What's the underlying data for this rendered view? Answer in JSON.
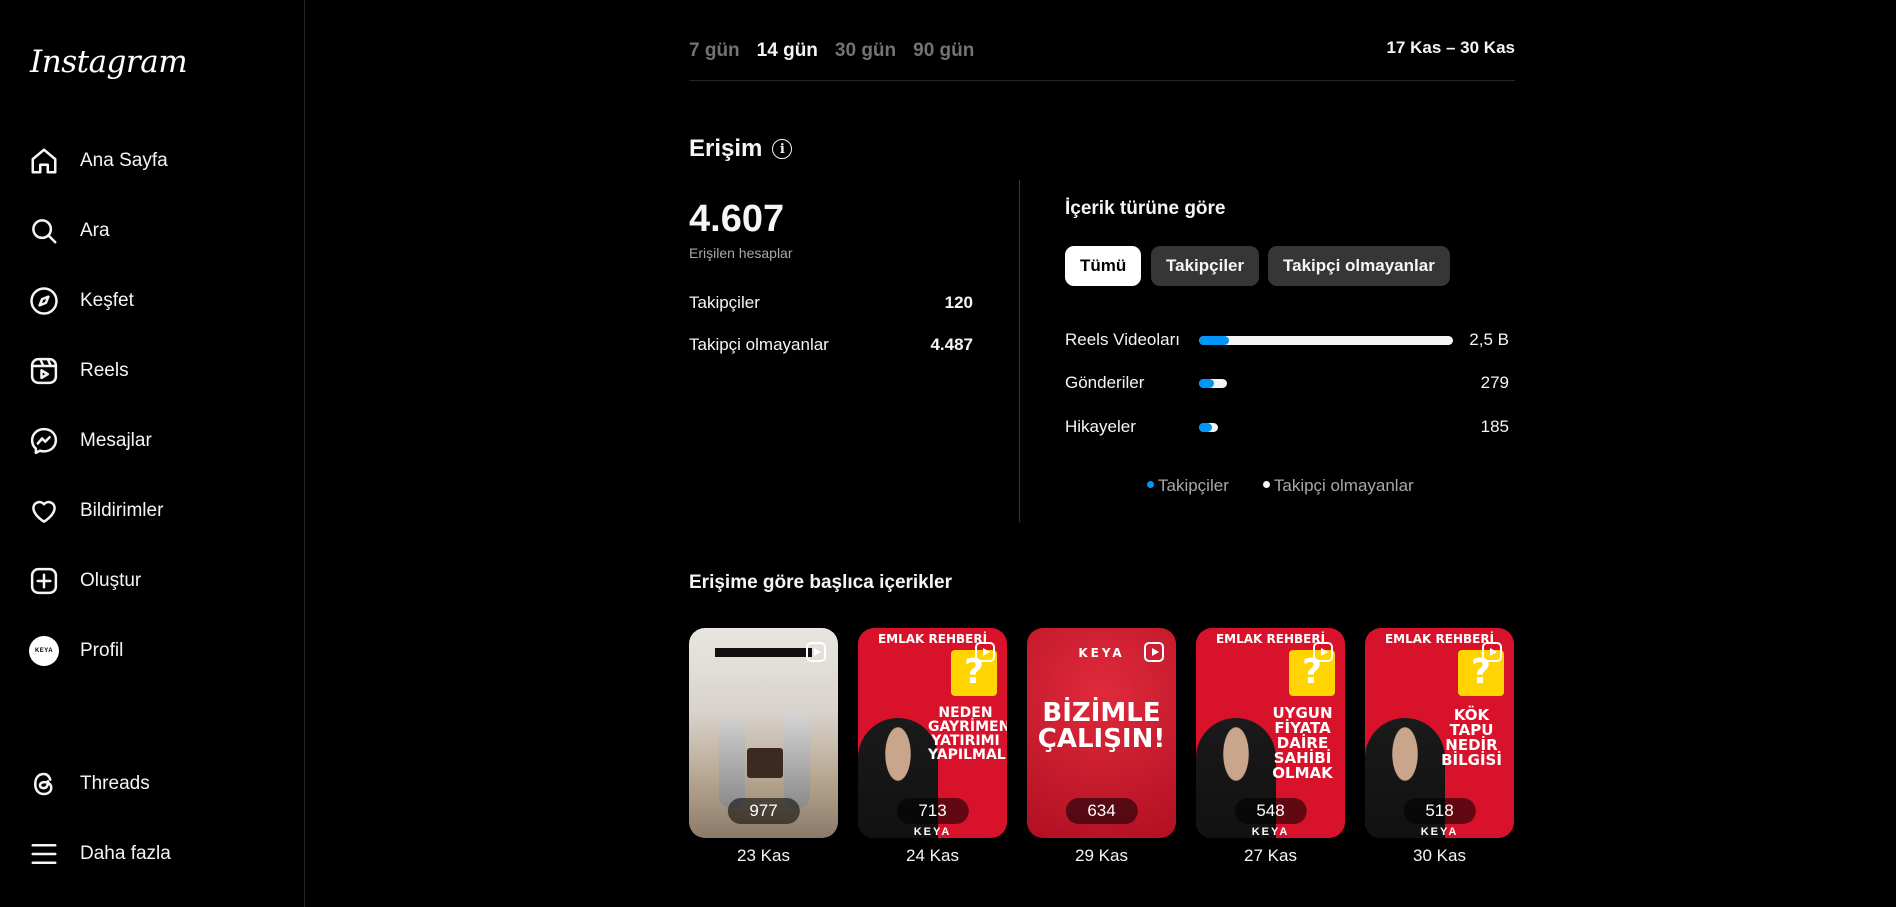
{
  "sidebar": {
    "logo": "Instagram",
    "items": [
      {
        "label": "Ana Sayfa",
        "icon": "home-icon"
      },
      {
        "label": "Ara",
        "icon": "search-icon"
      },
      {
        "label": "Keşfet",
        "icon": "compass-icon"
      },
      {
        "label": "Reels",
        "icon": "reels-icon"
      },
      {
        "label": "Mesajlar",
        "icon": "messenger-icon"
      },
      {
        "label": "Bildirimler",
        "icon": "heart-icon"
      },
      {
        "label": "Oluştur",
        "icon": "plus-square-icon"
      },
      {
        "label": "Profil",
        "icon": "avatar"
      },
      {
        "label": "Threads",
        "icon": "threads-icon"
      },
      {
        "label": "Daha fazla",
        "icon": "menu-icon"
      }
    ],
    "avatar_text": "KEYA"
  },
  "period": {
    "tabs": [
      "7 gün",
      "14 gün",
      "30 gün",
      "90 gün"
    ],
    "active": "14 gün",
    "range": "17 Kas – 30 Kas"
  },
  "reach": {
    "title": "Erişim",
    "total": "4.607",
    "total_label": "Erişilen hesaplar",
    "followers_label": "Takipçiler",
    "followers_value": "120",
    "non_followers_label": "Takipçi olmayanlar",
    "non_followers_value": "4.487"
  },
  "content_type": {
    "title": "İçerik türüne göre",
    "filters": [
      "Tümü",
      "Takipçiler",
      "Takipçi olmayanlar"
    ],
    "active_filter": "Tümü",
    "rows": [
      {
        "label": "Reels Videoları",
        "value": "2,5 B",
        "total_fraction": 1.0,
        "follower_fraction": 0.12
      },
      {
        "label": "Gönderiler",
        "value": "279",
        "total_fraction": 0.11,
        "follower_fraction": 0.06
      },
      {
        "label": "Hikayeler",
        "value": "185",
        "total_fraction": 0.074,
        "follower_fraction": 0.05
      }
    ],
    "legend": [
      {
        "label": "Takipçiler",
        "color": "#0095f6"
      },
      {
        "label": "Takipçi olmayanlar",
        "color": "#f5f5f5"
      }
    ]
  },
  "top_content": {
    "title": "Erişime göre başlıca içerikler",
    "items": [
      {
        "count": "977",
        "date": "23 Kas"
      },
      {
        "count": "713",
        "date": "24 Kas",
        "brand": "EMLAK REHBERİ",
        "headline": "NEDEN GAYRİMENKUL YATIRIMI YAPILMALI?"
      },
      {
        "count": "634",
        "date": "29 Kas",
        "brand": "KEYA",
        "headline": "BİZİMLE ÇALIŞIN!"
      },
      {
        "count": "548",
        "date": "27 Kas",
        "brand": "EMLAK REHBERİ",
        "headline": "UYGUN FİYATA DAİRE SAHİBİ OLMAK"
      },
      {
        "count": "518",
        "date": "30 Kas",
        "brand": "EMLAK REHBERİ",
        "headline": "KÖK TAPU NEDİR BİLGİSİ"
      }
    ]
  }
}
